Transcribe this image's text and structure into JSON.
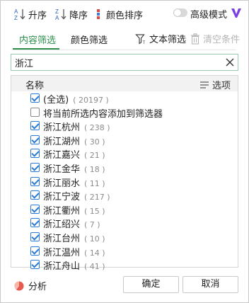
{
  "toolbar": {
    "sort_asc_label": "升序",
    "sort_desc_label": "降序",
    "color_sort_label": "颜色排序",
    "advanced_mode_label": "高级模式",
    "advanced_mode_on": false
  },
  "tabs": {
    "content_filter": "内容筛选",
    "color_filter": "颜色筛选",
    "text_filter": "文本筛选",
    "clear_conditions": "清空条件"
  },
  "search": {
    "value": "浙江"
  },
  "list": {
    "header_name": "名称",
    "header_options": "选项",
    "items": [
      {
        "label": "(全选)",
        "count": "( 20197 )",
        "checked": true
      },
      {
        "label": "将当前所选内容添加到筛选器",
        "count": "",
        "checked": false
      },
      {
        "label": "浙江杭州",
        "count": "( 238 )",
        "checked": true
      },
      {
        "label": "浙江湖州",
        "count": "( 30 )",
        "checked": true
      },
      {
        "label": "浙江嘉兴",
        "count": "( 21 )",
        "checked": true
      },
      {
        "label": "浙江金华",
        "count": "( 18 )",
        "checked": true
      },
      {
        "label": "浙江丽水",
        "count": "( 11 )",
        "checked": true
      },
      {
        "label": "浙江宁波",
        "count": "( 217 )",
        "checked": true
      },
      {
        "label": "浙江衢州",
        "count": "( 15 )",
        "checked": true
      },
      {
        "label": "浙江绍兴",
        "count": "( 7 )",
        "checked": true
      },
      {
        "label": "浙江台州",
        "count": "( 10 )",
        "checked": true
      },
      {
        "label": "浙江温州",
        "count": "( 14 )",
        "checked": true
      },
      {
        "label": "浙江舟山",
        "count": "( 41 )",
        "checked": true
      }
    ]
  },
  "footer": {
    "analysis_label": "分析",
    "ok_label": "确定",
    "cancel_label": "取消"
  },
  "colors": {
    "accent_green": "#2e8f4e",
    "checkbox_blue": "#2b7bd4",
    "vip_purple": "#7b3fe4"
  }
}
